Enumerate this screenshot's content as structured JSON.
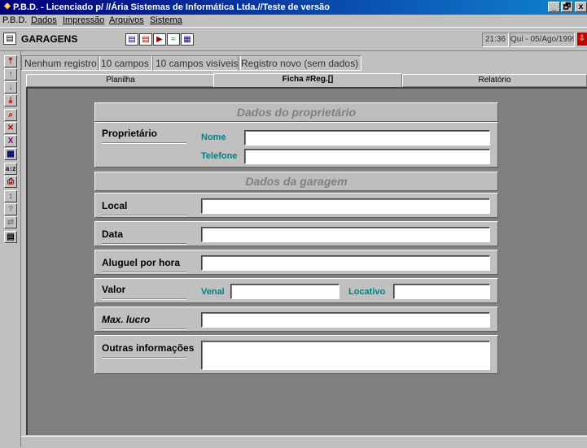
{
  "window": {
    "title": "P.B.D. - Licenciado p/ //Ária Sistemas de Informática Ltda.//Teste de versão",
    "controls": [
      "_",
      "🗗",
      "x"
    ]
  },
  "menu": [
    "P.B.D.",
    "Dados",
    "Impressão",
    "Arquivos",
    "Sistema"
  ],
  "toolbar": {
    "module_title": "GARAGENS",
    "clock": "21:36",
    "date": "Qui - 05/Ago/1999",
    "icons": [
      "save-icon",
      "print-icon",
      "print-preview-icon",
      "chart-icon",
      "report-icon"
    ]
  },
  "status": [
    "Nenhum registro",
    "10 campos",
    "10 campos visíveis",
    "Registro novo (sem dados)"
  ],
  "side_toolbar": [
    "first-record-icon",
    "previous-record-icon",
    "next-record-icon",
    "last-record-icon",
    "new-record-icon",
    "delete-record-icon",
    "filter-icon",
    "grid-icon",
    "sort-icon",
    "print-icon",
    "calculate-icon",
    "query-icon",
    "dual-view-icon",
    "calculator-icon"
  ],
  "tabs": [
    "Planilha",
    "Ficha  #Reg.[]",
    "Relatório"
  ],
  "form": {
    "section_owner": "Dados do proprietário",
    "section_garage": "Dados da garagem",
    "owner_label": "Proprietário",
    "name_label": "Nome",
    "phone_label": "Telefone",
    "local_label": "Local",
    "date_label": "Data",
    "rent_label": "Aluguel por hora",
    "value_label": "Valor",
    "venal_label": "Venal",
    "locativo_label": "Locativo",
    "max_profit_label": "Max. lucro",
    "other_info_label": "Outras informações",
    "values": {
      "nome": "",
      "telefone": "",
      "local": "",
      "data": "",
      "aluguel": "",
      "venal": "",
      "locativo": "",
      "max_lucro": "",
      "outras": ""
    }
  }
}
